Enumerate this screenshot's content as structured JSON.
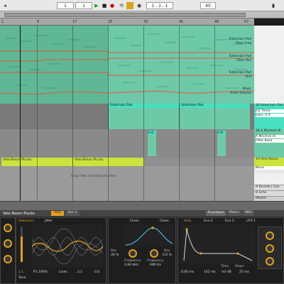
{
  "transport": {
    "tempo": "1",
    "signature": "1",
    "position": "1 . 1 . 1",
    "loop_start": "1",
    "loop_len": "1",
    "zoom": "4",
    "right_value": "40"
  },
  "arrangement": {
    "ruler_ticks": [
      "1",
      "9",
      "17",
      "25",
      "33",
      "41",
      "49",
      "57"
    ],
    "automation": {
      "label_sidechain_freq": "Sidechain Pad",
      "label_filter_freq": "Filter Freq",
      "label_sidechain_res": "Sidechain Pad",
      "label_filter_res": "Filter Res",
      "label_sidechain_lfo": "Sidechain Pad",
      "label_lfo": "LFO",
      "label_mixer": "Mixer",
      "label_track_volume": "Track Volume"
    },
    "pad_clip_1": "Sidechain Pad",
    "pad_clip_2": "Sidechain Pad",
    "hihat_clip_1": "A Hi",
    "hihat_clip_2": "A Hi",
    "pluck_clip_1": "Velo-Reson Plucks",
    "pluck_clip_2": "Velo-Reson Plucks",
    "drop_hint": "Drop Files and Devices Here"
  },
  "tracks": {
    "pad": {
      "name": "16 Sidechain Pad",
      "sub1": "EQ Three",
      "sub2": "Gain: 0.0"
    },
    "hihat": {
      "name": "18 A Minimal Hi",
      "sub1": "A Minimal Hi",
      "sub2": "Filter Reso"
    },
    "pluck": {
      "name": "19 Velo-Reson",
      "sub1": "None"
    },
    "reverb": {
      "name": "A Reverb | Con"
    },
    "echo": {
      "name": "B Echo"
    },
    "master": {
      "name": "Master"
    }
  },
  "device": {
    "title": "Velo-Reson Plucks",
    "tab1": "Velo",
    "tab2": "Osc 2",
    "osc_mode": "Sidechain",
    "osc_type": "Jitter",
    "osc_label1": "Tone",
    "osc_val1": "1.1",
    "osc_val2": "0.0",
    "osc_val3": "Lines",
    "osc_val4": "2.1",
    "osc_detail": "P1 100%",
    "filter_type": "Clean",
    "filter_type2": "Clean",
    "filter_freq_label": "Frequency",
    "filter_freq_val": "2.84 kHz",
    "filter_res_label": "Res",
    "filter_res_val": "30 %",
    "filter_freq2_label": "Frequency",
    "filter_freq2_val": "690 Hz",
    "filter_res2_label": "Res",
    "filter_res2_val": "0.0 %",
    "env_tab1": "Amp",
    "env_tab2": "Env 2",
    "env_tab3": "Env 3",
    "env_tab4": "LFO 1",
    "env_attack": "0.00 ms",
    "env_decay": "142 ms",
    "env_sustain": "-inf dB",
    "env_release": "25 ms",
    "env_time_label": "Time",
    "env_slope_label": "Slope",
    "right_tabs": [
      "Envelopes",
      "Matrix",
      "MIDI"
    ]
  },
  "colors": {
    "teal": "#6ec9a8",
    "bright_teal": "#46e0bf",
    "lime": "#cde23a",
    "orange": "#e0a11d"
  }
}
